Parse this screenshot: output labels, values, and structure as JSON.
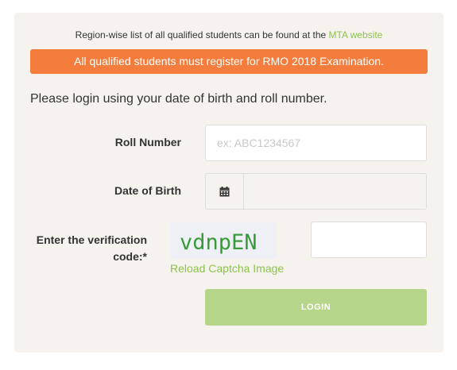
{
  "notice": {
    "text": "Region-wise list of all qualified students can be found at the ",
    "link_label": "MTA website"
  },
  "alert": {
    "text": "All qualified students must register for RMO 2018 Examination.",
    "color": "#f47c3c"
  },
  "intro": "Please login using your date of birth and roll number.",
  "form": {
    "roll_label": "Roll Number",
    "roll_placeholder": "ex: ABC1234567",
    "roll_value": "",
    "dob_label": "Date of Birth",
    "dob_icon": "calendar-icon",
    "dob_value": "",
    "captcha_label": "Enter the verification code:*",
    "captcha_text": "vdnpEN",
    "captcha_color": "#3a9b3a",
    "reload_label": "Reload Captcha Image",
    "captcha_input_value": "",
    "login_label": "LOGIN",
    "accent_color": "#8bc34a"
  }
}
